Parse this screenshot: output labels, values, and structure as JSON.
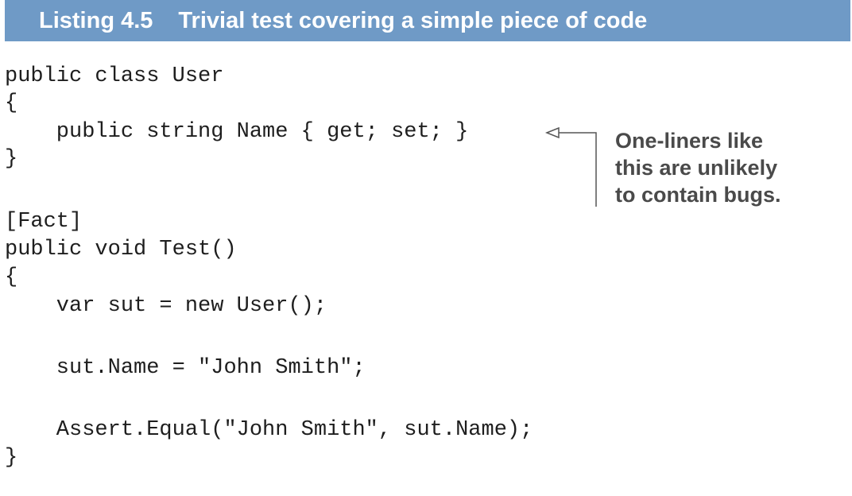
{
  "header": {
    "listing_number": "Listing 4.5",
    "title": "Trivial test covering a simple piece of code"
  },
  "code": {
    "lines": [
      "public class User",
      "{",
      "    public string Name { get; set; }",
      "}",
      "[Fact]",
      "public void Test()",
      "{",
      "    var sut = new User();",
      "    sut.Name = \"John Smith\";",
      "    Assert.Equal(\"John Smith\", sut.Name);",
      "}"
    ]
  },
  "annotation": {
    "lines": [
      "One-liners like",
      "this are unlikely",
      "to contain bugs."
    ]
  }
}
